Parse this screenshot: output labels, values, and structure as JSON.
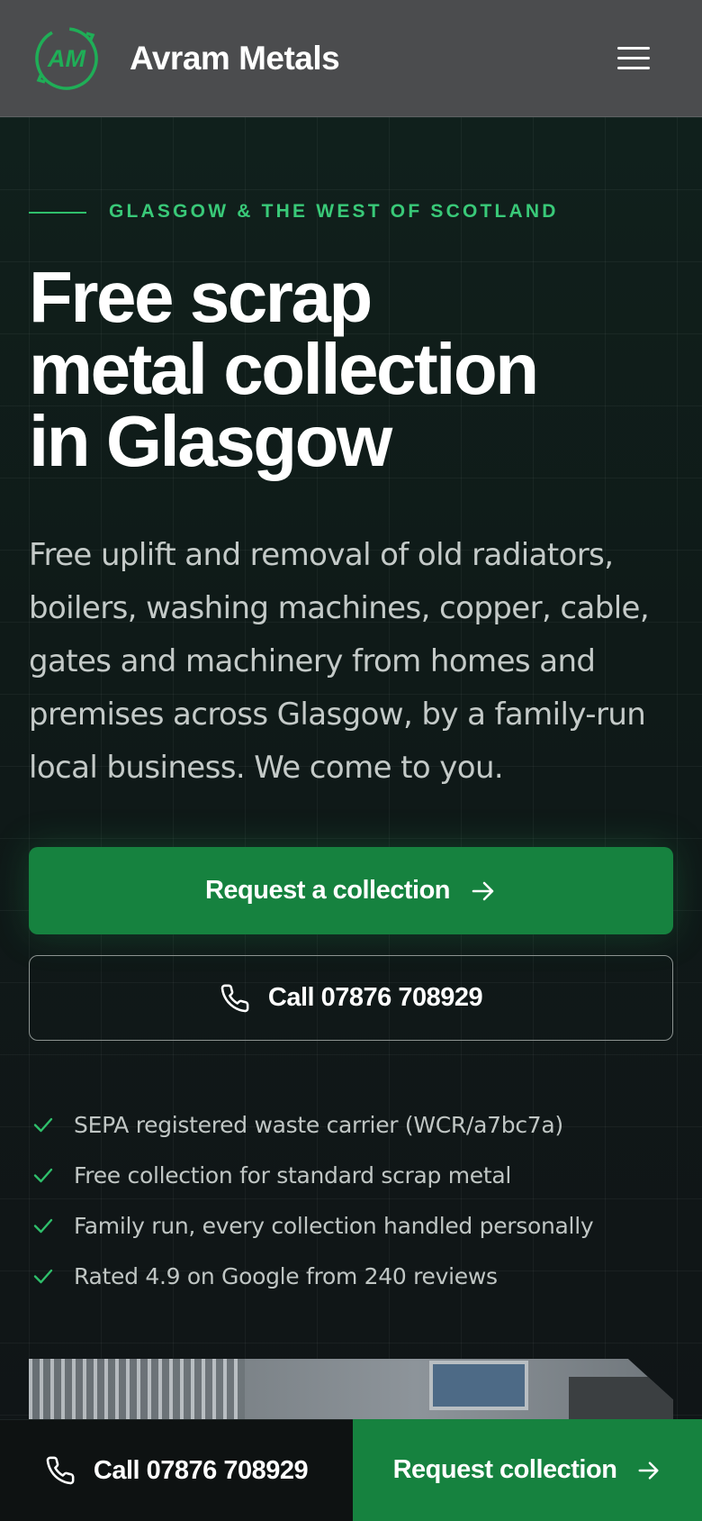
{
  "header": {
    "logo_text": "AM",
    "brand": "Avram Metals",
    "menu_icon": "hamburger-menu-icon"
  },
  "hero": {
    "eyebrow": "GLASGOW & THE WEST OF SCOTLAND",
    "headline_lines": [
      "Free scrap",
      "metal collection",
      "in Glasgow"
    ],
    "lead": "Free uplift and removal of old radiators, boilers, washing machines, copper, cable, gates and machinery from homes and premises across Glasgow, by a family-run local business. We come to you.",
    "primary_cta": "Request a collection",
    "secondary_cta": "Call 07876 708929",
    "checks": [
      "SEPA registered waste carrier (WCR/a7bc7a)",
      "Free collection for standard scrap metal",
      "Family run, every collection handled personally",
      "Rated 4.9 on Google from 240 reviews"
    ]
  },
  "bottom_bar": {
    "call_label": "Call 07876 708929",
    "request_label": "Request collection"
  },
  "colors": {
    "accent_green": "#16823f",
    "eyebrow_green": "#39c978",
    "header_bg": "#4b4c4e"
  }
}
